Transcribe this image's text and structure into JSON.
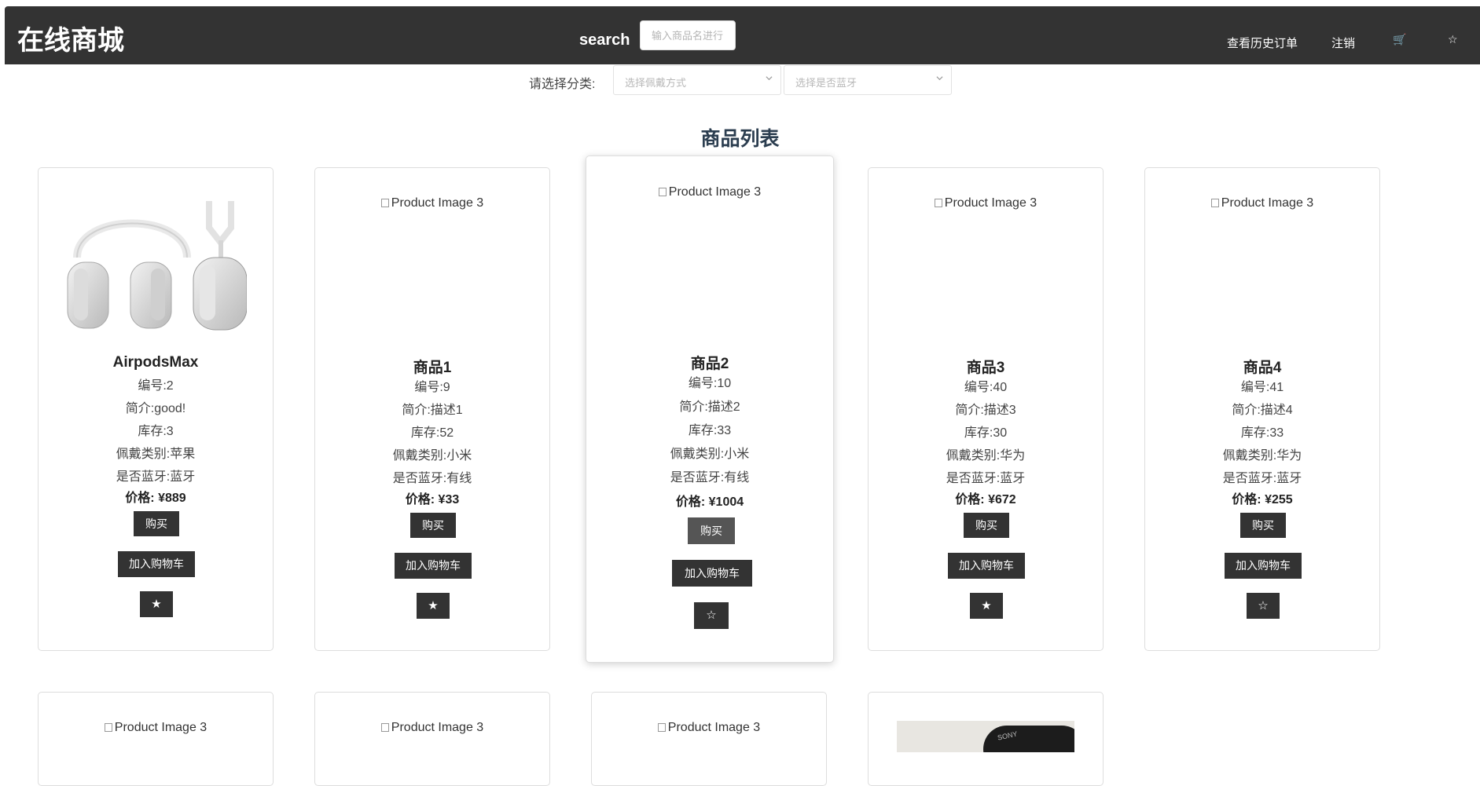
{
  "header": {
    "brand": "在线商城",
    "search_label": "search",
    "search_placeholder": "输入商品名进行",
    "nav": {
      "orders": "查看历史订单",
      "logout": "注销",
      "cart_icon": "🛒",
      "favorites_icon": "☆"
    }
  },
  "filters": {
    "label": "请选择分类:",
    "wear_placeholder": "选择佩戴方式",
    "bluetooth_placeholder": "选择是否蓝牙"
  },
  "section_title": "商品列表",
  "labels": {
    "id": "编号:",
    "desc": "简介:",
    "stock": "库存:",
    "category": "佩戴类别:",
    "bluetooth": "是否蓝牙:",
    "price": "价格: ¥",
    "buy": "购买",
    "add_cart": "加入购物车",
    "img_alt": "Product Image 3"
  },
  "products": [
    {
      "name": "AirpodsMax",
      "id": "2",
      "desc": "good!",
      "stock": "3",
      "category": "苹果",
      "bluetooth": "蓝牙",
      "price": "889",
      "star": "★",
      "image": "headphones"
    },
    {
      "name": "商品1",
      "id": "9",
      "desc": "描述1",
      "stock": "52",
      "category": "小米",
      "bluetooth": "有线",
      "price": "33",
      "star": "★",
      "image": "broken"
    },
    {
      "name": "商品2",
      "id": "10",
      "desc": "描述2",
      "stock": "33",
      "category": "小米",
      "bluetooth": "有线",
      "price": "1004",
      "star": "☆",
      "image": "broken"
    },
    {
      "name": "商品3",
      "id": "40",
      "desc": "描述3",
      "stock": "30",
      "category": "华为",
      "bluetooth": "蓝牙",
      "price": "672",
      "star": "★",
      "image": "broken"
    },
    {
      "name": "商品4",
      "id": "41",
      "desc": "描述4",
      "stock": "33",
      "category": "华为",
      "bluetooth": "蓝牙",
      "price": "255",
      "star": "☆",
      "image": "broken"
    }
  ],
  "row2_images": [
    "broken",
    "broken",
    "broken",
    "photo"
  ],
  "row2_photo_brand": "SONY"
}
